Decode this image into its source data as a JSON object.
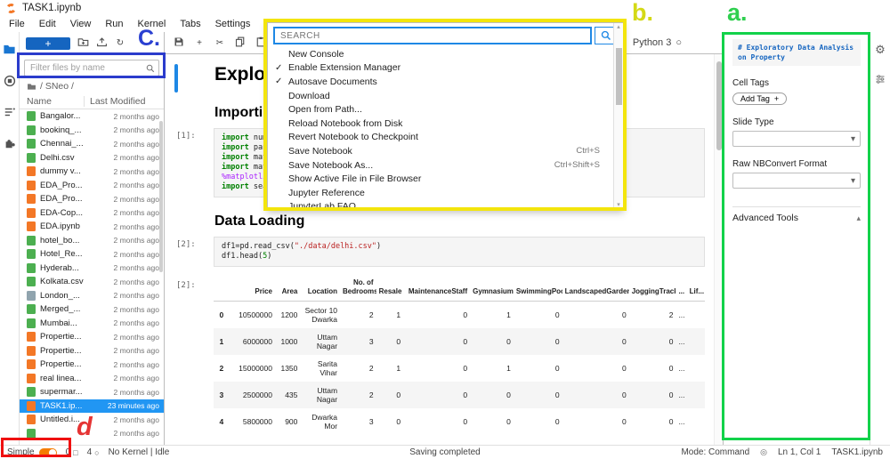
{
  "titlebar": {
    "title": "TASK1.ipynb"
  },
  "menubar": {
    "items": [
      "File",
      "Edit",
      "View",
      "Run",
      "Kernel",
      "Tabs",
      "Settings",
      "Help"
    ]
  },
  "icons": {
    "add": "+",
    "cut": "✂",
    "run": "▶",
    "stop": "■",
    "restart": "↻",
    "run_all": "▶▶",
    "gear": "⚙",
    "kernel_circle": "○",
    "terminal_square": "□",
    "status_circle": "◎",
    "chevron_down": "▾",
    "caret_up": "▴",
    "check": "✓"
  },
  "file_browser": {
    "new_button": "+",
    "filter_placeholder": "Filter files by name",
    "breadcrumb": "/ SNeo /",
    "columns": {
      "name": "Name",
      "modified": "Last Modified"
    },
    "files": [
      {
        "name": "Bangalor...",
        "modified": "2 months ago",
        "type": "csv"
      },
      {
        "name": "bookinq_...",
        "modified": "2 months ago",
        "type": "csv"
      },
      {
        "name": "Chennai_...",
        "modified": "2 months ago",
        "type": "csv"
      },
      {
        "name": "Delhi.csv",
        "modified": "2 months ago",
        "type": "csv"
      },
      {
        "name": "dummy v...",
        "modified": "2 months ago",
        "type": "ipynb"
      },
      {
        "name": "EDA_Pro...",
        "modified": "2 months ago",
        "type": "ipynb"
      },
      {
        "name": "EDA_Pro...",
        "modified": "2 months ago",
        "type": "ipynb"
      },
      {
        "name": "EDA-Cop...",
        "modified": "2 months ago",
        "type": "ipynb"
      },
      {
        "name": "EDA.ipynb",
        "modified": "2 months ago",
        "type": "ipynb"
      },
      {
        "name": "hotel_bo...",
        "modified": "2 months ago",
        "type": "csv"
      },
      {
        "name": "Hotel_Re...",
        "modified": "2 months ago",
        "type": "csv"
      },
      {
        "name": "Hyderab...",
        "modified": "2 months ago",
        "type": "csv"
      },
      {
        "name": "Kolkata.csv",
        "modified": "2 months ago",
        "type": "csv"
      },
      {
        "name": "London_...",
        "modified": "2 months ago",
        "type": "doc"
      },
      {
        "name": "Merged_...",
        "modified": "2 months ago",
        "type": "csv"
      },
      {
        "name": "Mumbai...",
        "modified": "2 months ago",
        "type": "csv"
      },
      {
        "name": "Propertie...",
        "modified": "2 months ago",
        "type": "ipynb"
      },
      {
        "name": "Propertie...",
        "modified": "2 months ago",
        "type": "ipynb"
      },
      {
        "name": "Propertie...",
        "modified": "2 months ago",
        "type": "ipynb"
      },
      {
        "name": "real linea...",
        "modified": "2 months ago",
        "type": "ipynb"
      },
      {
        "name": "supermar...",
        "modified": "2 months ago",
        "type": "csv"
      },
      {
        "name": "TASK1.ip...",
        "modified": "23 minutes ago",
        "type": "ipynb",
        "selected": true
      },
      {
        "name": "Untitled.i...",
        "modified": "2 months ago",
        "type": "ipynb"
      },
      {
        "name": "",
        "modified": "2 months ago",
        "type": "csv"
      }
    ]
  },
  "nb_toolbar": {
    "kernel_label": "Python 3"
  },
  "file_menu": {
    "search_placeholder": "SEARCH",
    "items": [
      {
        "label": "New Console"
      },
      {
        "label": "Enable Extension Manager",
        "checked": true
      },
      {
        "label": "Autosave Documents",
        "checked": true
      },
      {
        "label": "Download"
      },
      {
        "label": "Open from Path..."
      },
      {
        "label": "Reload Notebook from Disk"
      },
      {
        "label": "Revert Notebook to Checkpoint"
      },
      {
        "label": "Save Notebook",
        "shortcut": "Ctrl+S"
      },
      {
        "label": "Save Notebook As...",
        "shortcut": "Ctrl+Shift+S"
      },
      {
        "label": "Show Active File in File Browser"
      },
      {
        "label": "Jupyter Reference"
      },
      {
        "label": "JupyterLab FAQ"
      }
    ]
  },
  "notebook": {
    "heading1": "Exploratory Data Analysis on Property",
    "heading2": "Importing Libraries",
    "cell1_prompt": "[1]:",
    "cell1_code": [
      "import numpy as np",
      "import pandas as pd",
      "import matplotlib.pyplot as plt",
      "import matplotlib",
      "%matplotlib inline",
      "import seaborn as sns"
    ],
    "heading3": "Data Loading",
    "cell2_prompt": "[2]:",
    "cell2_code": [
      "df1=pd.read_csv(\"./data/delhi.csv\")",
      "df1.head(5)"
    ],
    "output_prompt": "[2]:",
    "table": {
      "columns": [
        "",
        "Price",
        "Area",
        "Location",
        "No. of Bedrooms",
        "Resale",
        "MaintenanceStaff",
        "Gymnasium",
        "SwimmingPool",
        "LandscapedGardens",
        "JoggingTrack",
        "...",
        "Lif..."
      ],
      "rows": [
        [
          "0",
          "10500000",
          "1200",
          "Sector 10 Dwarka",
          "2",
          "1",
          "0",
          "1",
          "0",
          "0",
          "2",
          "...",
          ""
        ],
        [
          "1",
          "6000000",
          "1000",
          "Uttam Nagar",
          "3",
          "0",
          "0",
          "0",
          "0",
          "0",
          "0",
          "...",
          ""
        ],
        [
          "2",
          "15000000",
          "1350",
          "Sarita Vihar",
          "2",
          "1",
          "0",
          "1",
          "0",
          "0",
          "0",
          "...",
          ""
        ],
        [
          "3",
          "2500000",
          "435",
          "Uttam Nagar",
          "2",
          "0",
          "0",
          "0",
          "0",
          "0",
          "0",
          "...",
          ""
        ],
        [
          "4",
          "5800000",
          "900",
          "Dwarka Mor",
          "3",
          "0",
          "0",
          "0",
          "0",
          "0",
          "0",
          "...",
          ""
        ]
      ]
    }
  },
  "right_panel": {
    "source_line1": "# Exploratory Data Analysis",
    "source_line2": "on Property",
    "cell_tags_label": "Cell Tags",
    "add_tag_label": "Add Tag",
    "slide_type_label": "Slide Type",
    "raw_format_label": "Raw NBConvert Format",
    "advanced_tools_label": "Advanced Tools"
  },
  "statusbar": {
    "simple_label": "Simple",
    "terminals": "0",
    "kernels": "4",
    "kernel_status": "No Kernel | Idle",
    "saving": "Saving completed",
    "mode": "Mode: Command",
    "position": "Ln 1, Col 1",
    "filename": "TASK1.ipynb"
  },
  "annotations": {
    "a": "a.",
    "b": "b.",
    "c": "C.",
    "d": "d"
  },
  "colors": {
    "accent": "#1e88e5",
    "selection": "#2196f3",
    "jupyter_orange": "#f37726",
    "toggle_orange": "#f57c00",
    "box_green": "#12d24a",
    "box_yellow": "#f3e50c",
    "box_blue": "#2b3ccc",
    "box_red": "#ef1010",
    "csv_icon_green": "#4caf50",
    "notebook_icon_orange": "#f37726"
  }
}
